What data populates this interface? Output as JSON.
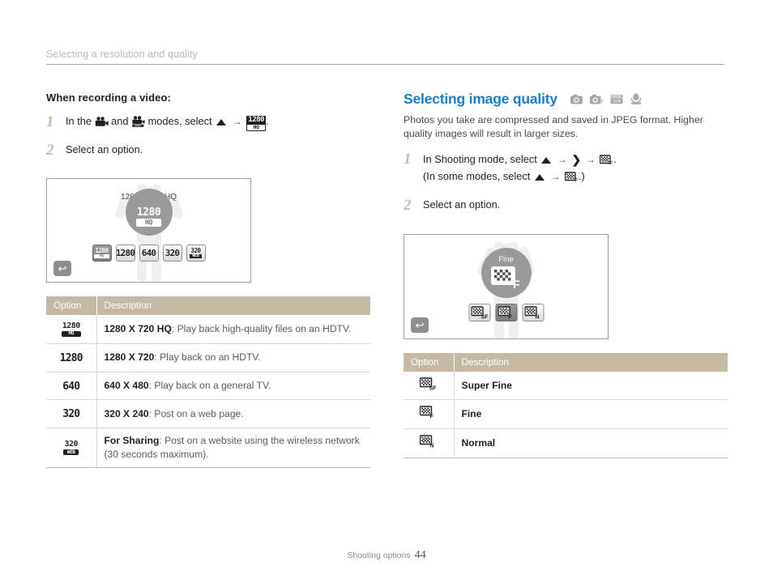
{
  "runhead": {
    "text": "Selecting a resolution and quality"
  },
  "left": {
    "subhead": "When recording a video:",
    "step1_a": "In the",
    "step1_b": "and",
    "step1_c": "modes, select",
    "step1_end": ".",
    "step2": "Select an option.",
    "screen": {
      "caption": "1280 X 720 HQ",
      "circle_top": "1280",
      "circle_bottom": "HQ",
      "options": [
        {
          "name": "1280hq-option",
          "top": "1280",
          "bottom": "HQ",
          "selected": true
        },
        {
          "name": "1280-option",
          "top": "1280",
          "bottom": "",
          "selected": false
        },
        {
          "name": "640-option",
          "top": "640",
          "bottom": "",
          "selected": false
        },
        {
          "name": "320-option",
          "top": "320",
          "bottom": "",
          "selected": false
        },
        {
          "name": "320web-option",
          "top": "320",
          "bottom": "WEB",
          "selected": false
        }
      ],
      "back_icon": "back-arrow-icon"
    },
    "table": {
      "headers": [
        "Option",
        "Description"
      ],
      "rows": [
        {
          "icon_top": "1280",
          "icon_bottom": "HQ",
          "term": "1280 X 720 HQ",
          "desc": ": Play back high-quality files on an HDTV."
        },
        {
          "icon_top": "1280",
          "icon_bottom": "",
          "term": "1280 X 720",
          "desc": ": Play back on an HDTV."
        },
        {
          "icon_top": "640",
          "icon_bottom": "",
          "term": "640 X 480",
          "desc": ": Play back on a general TV."
        },
        {
          "icon_top": "320",
          "icon_bottom": "",
          "term": "320 X 240",
          "desc": ": Post on a web page."
        },
        {
          "icon_top": "320",
          "icon_bottom": "WEB",
          "term": "For Sharing",
          "desc": ": Post on a website using the wireless network (30 seconds maximum)."
        }
      ]
    }
  },
  "right": {
    "title": "Selecting image quality",
    "title_color": "#1a7ec4",
    "mode_icons": [
      "camera-icon",
      "camera-program-icon",
      "scene-icon",
      "movie-icon"
    ],
    "lead": "Photos you take are compressed and saved in JPEG format. Higher quality images will result in larger sizes.",
    "step1_a": "In Shooting mode, select",
    "step1_end": ".",
    "step1_sub_a": "(In some modes, select",
    "step1_sub_end": ".)",
    "step2": "Select an option.",
    "screen": {
      "circle_label": "Fine",
      "options": [
        {
          "name": "super-fine-option",
          "letter": "SF",
          "selected": false
        },
        {
          "name": "fine-option",
          "letter": "F",
          "selected": true
        },
        {
          "name": "normal-option",
          "letter": "N",
          "selected": false
        }
      ],
      "back_icon": "back-arrow-icon"
    },
    "table": {
      "headers": [
        "Option",
        "Description"
      ],
      "rows": [
        {
          "letter": "SF",
          "desc": "Super Fine"
        },
        {
          "letter": "F",
          "desc": "Fine"
        },
        {
          "letter": "N",
          "desc": "Normal"
        }
      ]
    }
  },
  "footer": {
    "label": "Shooting options",
    "page": "44"
  }
}
